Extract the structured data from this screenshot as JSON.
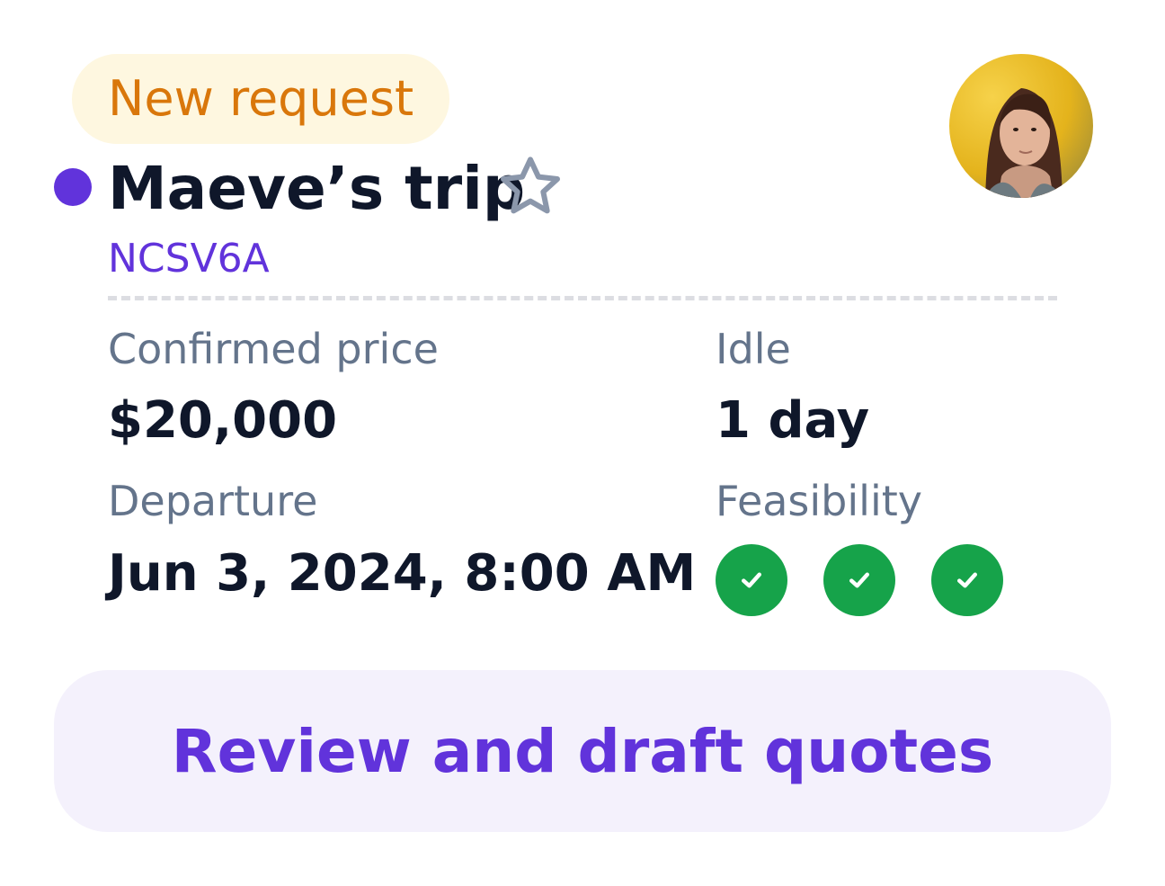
{
  "badge": {
    "label": "New request"
  },
  "trip": {
    "title": "Maeve’s trip",
    "reference": "NCSV6A"
  },
  "avatar": {
    "icon": "user-photo-avatar"
  },
  "details": {
    "confirmed_price_label": "Confirmed price",
    "confirmed_price_value": "$20,000",
    "idle_label": "Idle",
    "idle_value": "1 day",
    "departure_label": "Departure",
    "departure_value": "Jun 3, 2024, 8:00 AM",
    "feasibility_label": "Feasibility",
    "feasibility_checks": [
      "check-icon",
      "check-icon",
      "check-icon"
    ]
  },
  "cta": {
    "label": "Review and draft quotes"
  },
  "colors": {
    "accent": "#6133db",
    "badge_text": "#d9770b",
    "badge_bg": "#fef7e0",
    "success": "#16a34a",
    "cta_bg": "#f4f1fc"
  }
}
